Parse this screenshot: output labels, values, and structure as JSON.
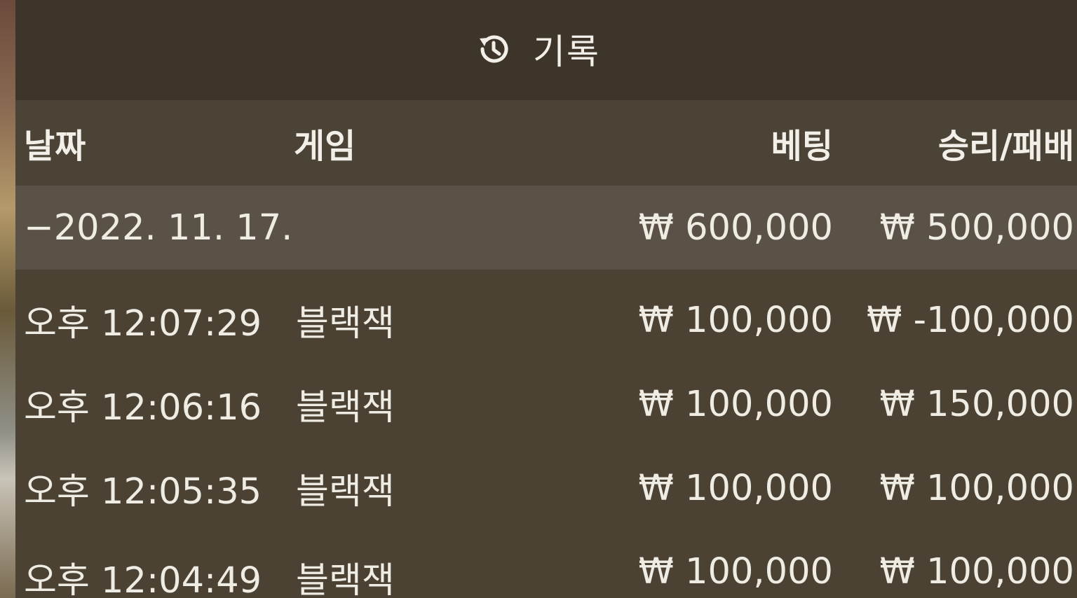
{
  "header": {
    "icon": "history-icon",
    "title": "기록"
  },
  "columns": {
    "date": "날짜",
    "game": "게임",
    "bet": "베팅",
    "result": "승리/패배"
  },
  "group": {
    "date": "−2022. 11. 17.",
    "bet": "₩ 600,000",
    "result": "₩ 500,000"
  },
  "rows": [
    {
      "time": "오후 12:07:29",
      "game": "블랙잭",
      "bet": "₩ 100,000",
      "result": "₩ -100,000"
    },
    {
      "time": "오후 12:06:16",
      "game": "블랙잭",
      "bet": "₩ 100,000",
      "result": "₩ 150,000"
    },
    {
      "time": "오후 12:05:35",
      "game": "블랙잭",
      "bet": "₩ 100,000",
      "result": "₩ 100,000"
    },
    {
      "time": "오후 12:04:49",
      "game": "블랙잭",
      "bet": "₩ 100,000",
      "result": "₩ 100,000"
    }
  ]
}
